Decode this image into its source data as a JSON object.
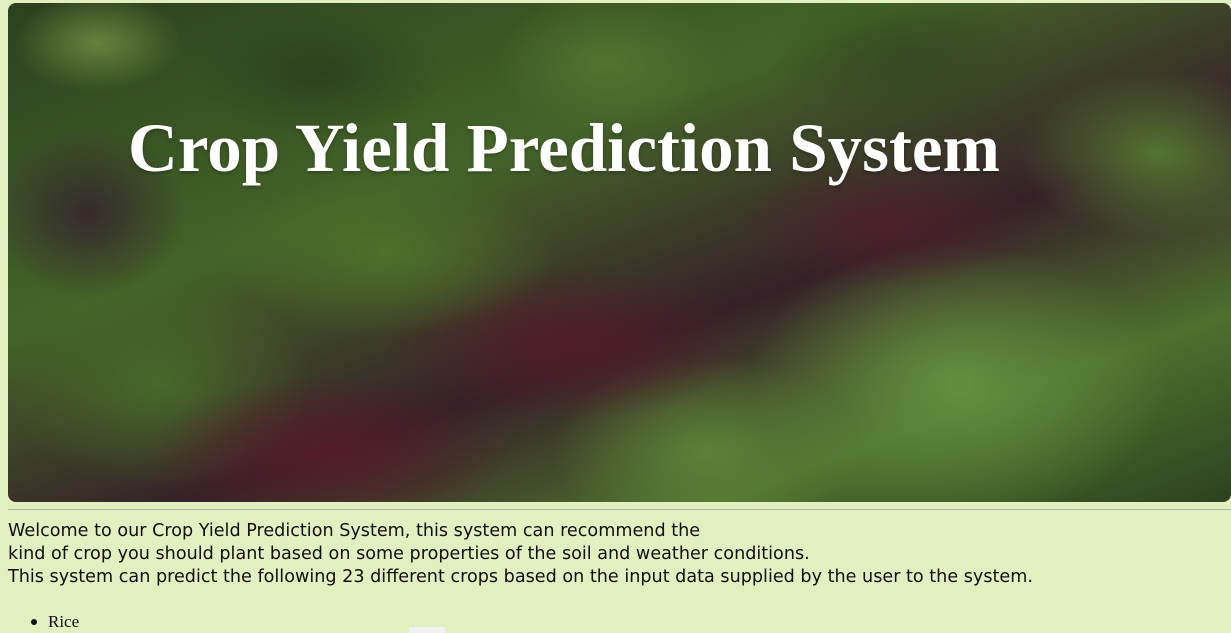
{
  "hero": {
    "title": "Crop Yield Prediction System"
  },
  "intro": {
    "line1": "Welcome to our Crop Yield Prediction System, this system can recommend the",
    "line2": "kind of crop you should plant based on some properties of the soil and weather conditions.",
    "line3": "This system can predict the following 23 different crops based on the input data supplied by the user to the system."
  },
  "crops": [
    {
      "label": "Rice"
    }
  ]
}
